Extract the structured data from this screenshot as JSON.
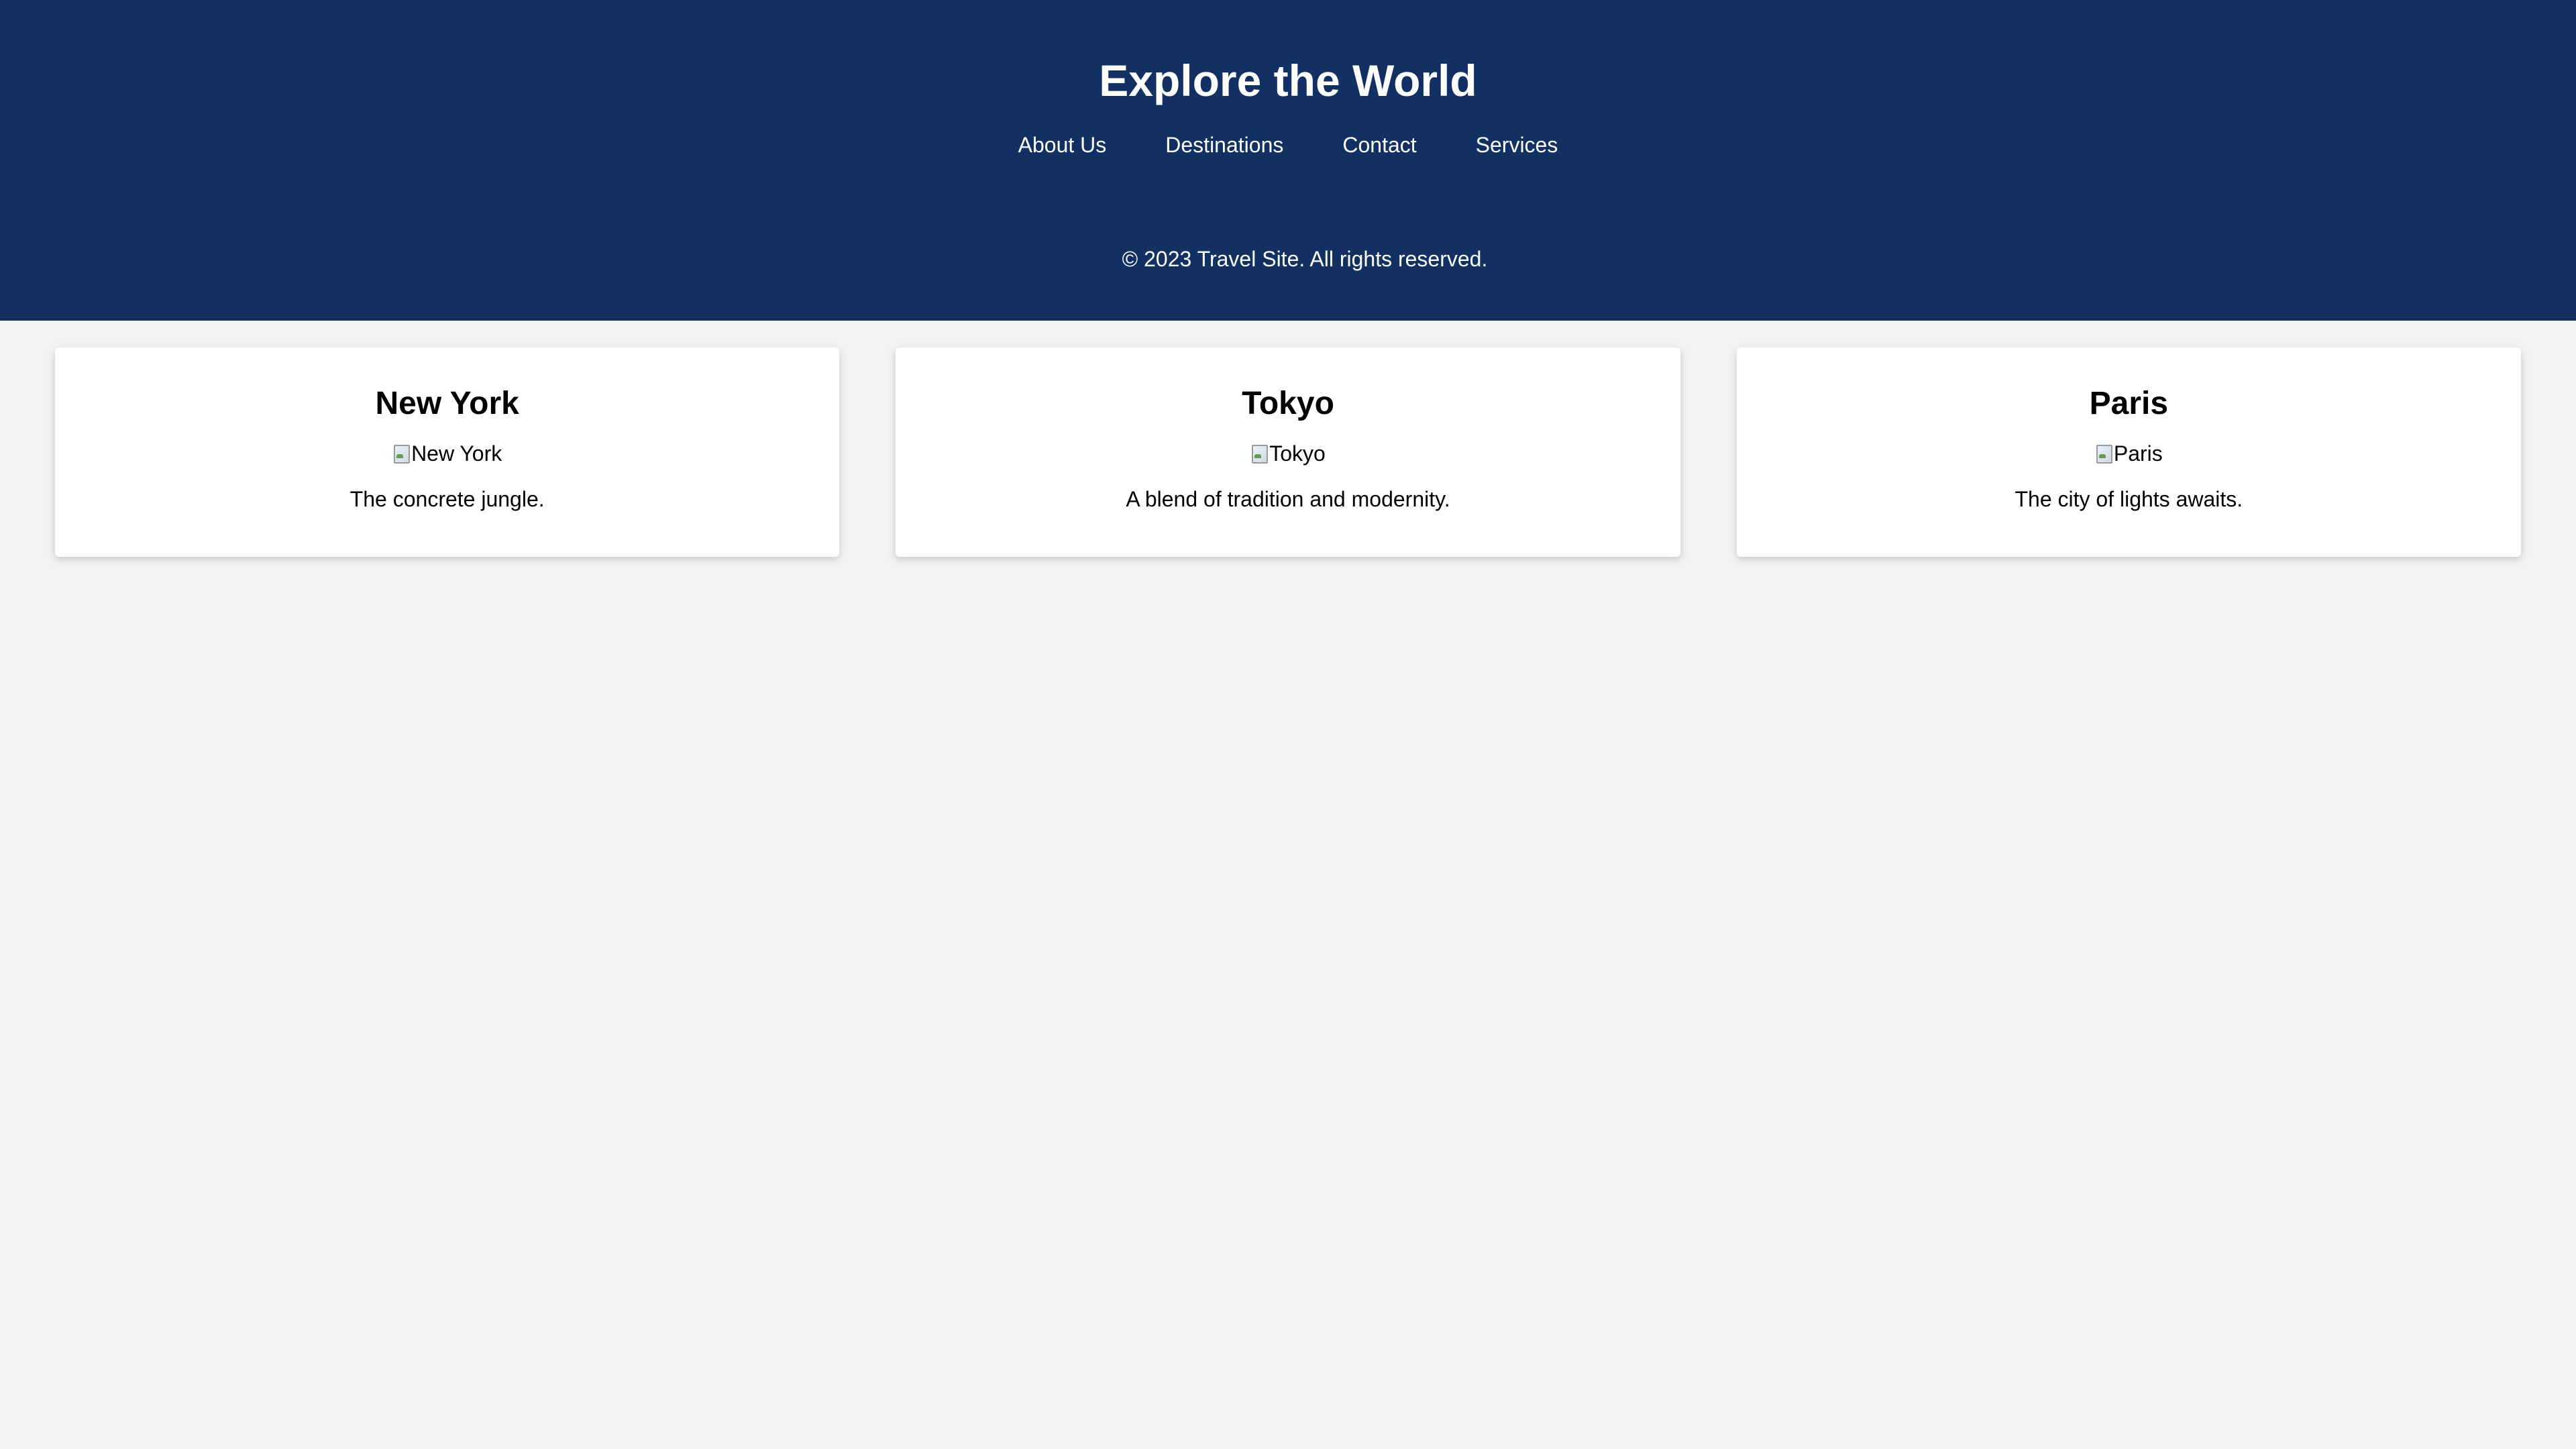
{
  "header": {
    "title": "Explore the World",
    "nav": [
      {
        "label": "About Us"
      },
      {
        "label": "Destinations"
      },
      {
        "label": "Contact"
      },
      {
        "label": "Services"
      }
    ],
    "copyright": "© 2023 Travel Site. All rights reserved."
  },
  "cards": [
    {
      "title": "New York",
      "image_alt": "New York",
      "description": "The concrete jungle."
    },
    {
      "title": "Tokyo",
      "image_alt": "Tokyo",
      "description": "A blend of tradition and modernity."
    },
    {
      "title": "Paris",
      "image_alt": "Paris",
      "description": "The city of lights awaits."
    }
  ],
  "colors": {
    "header_bg": "#123162",
    "page_bg": "#f3f3f3",
    "card_bg": "#ffffff"
  },
  "icons": {
    "broken_image": "broken-image-icon"
  }
}
